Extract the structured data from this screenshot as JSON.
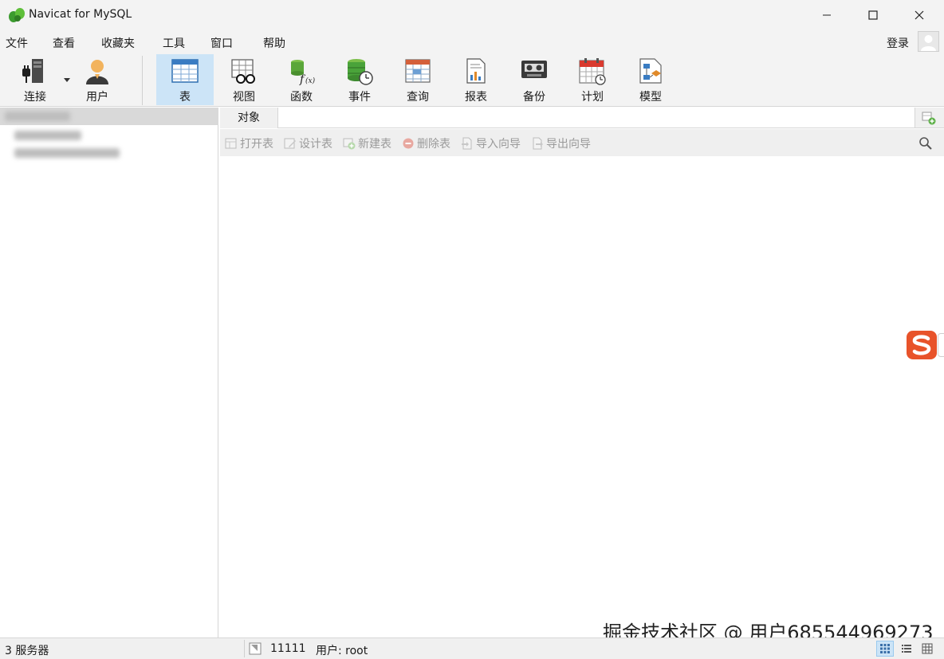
{
  "window": {
    "title": "Navicat for MySQL"
  },
  "menu": {
    "items": [
      "文件",
      "查看",
      "收藏夹",
      "工具",
      "窗口",
      "帮助"
    ],
    "login": "登录"
  },
  "toolbar": {
    "connect": "连接",
    "user": "用户",
    "table": "表",
    "view": "视图",
    "function": "函数",
    "event": "事件",
    "query": "查询",
    "report": "报表",
    "backup": "备份",
    "schedule": "计划",
    "model": "模型"
  },
  "tabs": {
    "objects": "对象"
  },
  "object_toolbar": {
    "open_table": "打开表",
    "design_table": "设计表",
    "new_table": "新建表",
    "delete_table": "删除表",
    "import_wizard": "导入向导",
    "export_wizard": "导出向导"
  },
  "statusbar": {
    "server_count": "3 服务器",
    "connection": "11111",
    "user": "用户: root"
  },
  "watermark": "掘金技术社区 @ 用户685544969273",
  "icons": [
    "navicat-logo-icon",
    "minimize-icon",
    "maximize-icon",
    "close-icon",
    "plug-icon",
    "user-icon",
    "table-icon",
    "view-icon",
    "function-icon",
    "event-icon",
    "query-icon",
    "report-icon",
    "backup-icon",
    "schedule-icon",
    "model-icon",
    "search-icon",
    "sogou-ime-icon"
  ],
  "colors": {
    "active_toolbar": "#cce4f7",
    "chrome": "#f3f3f3",
    "sogou": "#e8532a"
  }
}
